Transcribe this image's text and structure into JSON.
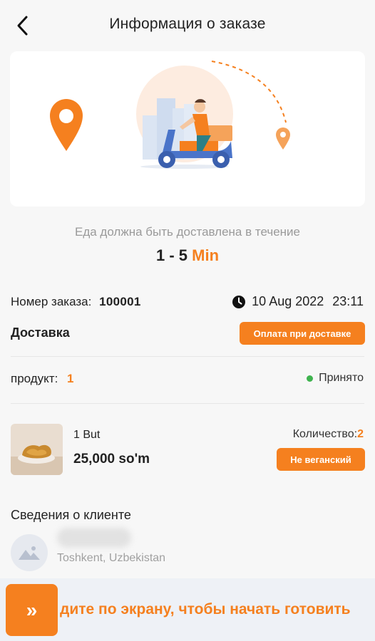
{
  "header": {
    "title": "Информация о заказе",
    "back_icon": "chevron-left-icon"
  },
  "hero": {
    "illustration": "delivery-scooter-illustration",
    "origin_icon": "location-pin-icon",
    "destination_icon": "location-pin-small-icon"
  },
  "eta": {
    "caption": "Еда должна быть доставлена в течение",
    "range": "1 - 5",
    "unit": "Min"
  },
  "order": {
    "number_label": "Номер заказа:",
    "number": "100001",
    "date": "10 Aug 2022",
    "time": "23:11",
    "clock_icon": "clock-icon",
    "type_label": "Доставка",
    "payment_label": "Оплата при доставке"
  },
  "products": {
    "label": "продукт:",
    "count": "1",
    "status": "Принято",
    "status_color": "#3fb34f"
  },
  "item": {
    "name": "1 But",
    "price": "25,000 so'm",
    "qty_label": "Количество:",
    "qty": "2",
    "tag": "Не веганский",
    "thumb_icon": "fried-chicken-photo"
  },
  "client": {
    "title": "Сведения о клиенте",
    "location": "Toshkent, Uzbekistan",
    "avatar_icon": "image-placeholder-icon"
  },
  "slider": {
    "text": "дите по экрану, чтобы начать готовить",
    "handle_glyph": "»",
    "handle_icon": "double-chevron-right-icon"
  },
  "colors": {
    "accent": "#f5801f",
    "background": "#f7f7f7"
  }
}
